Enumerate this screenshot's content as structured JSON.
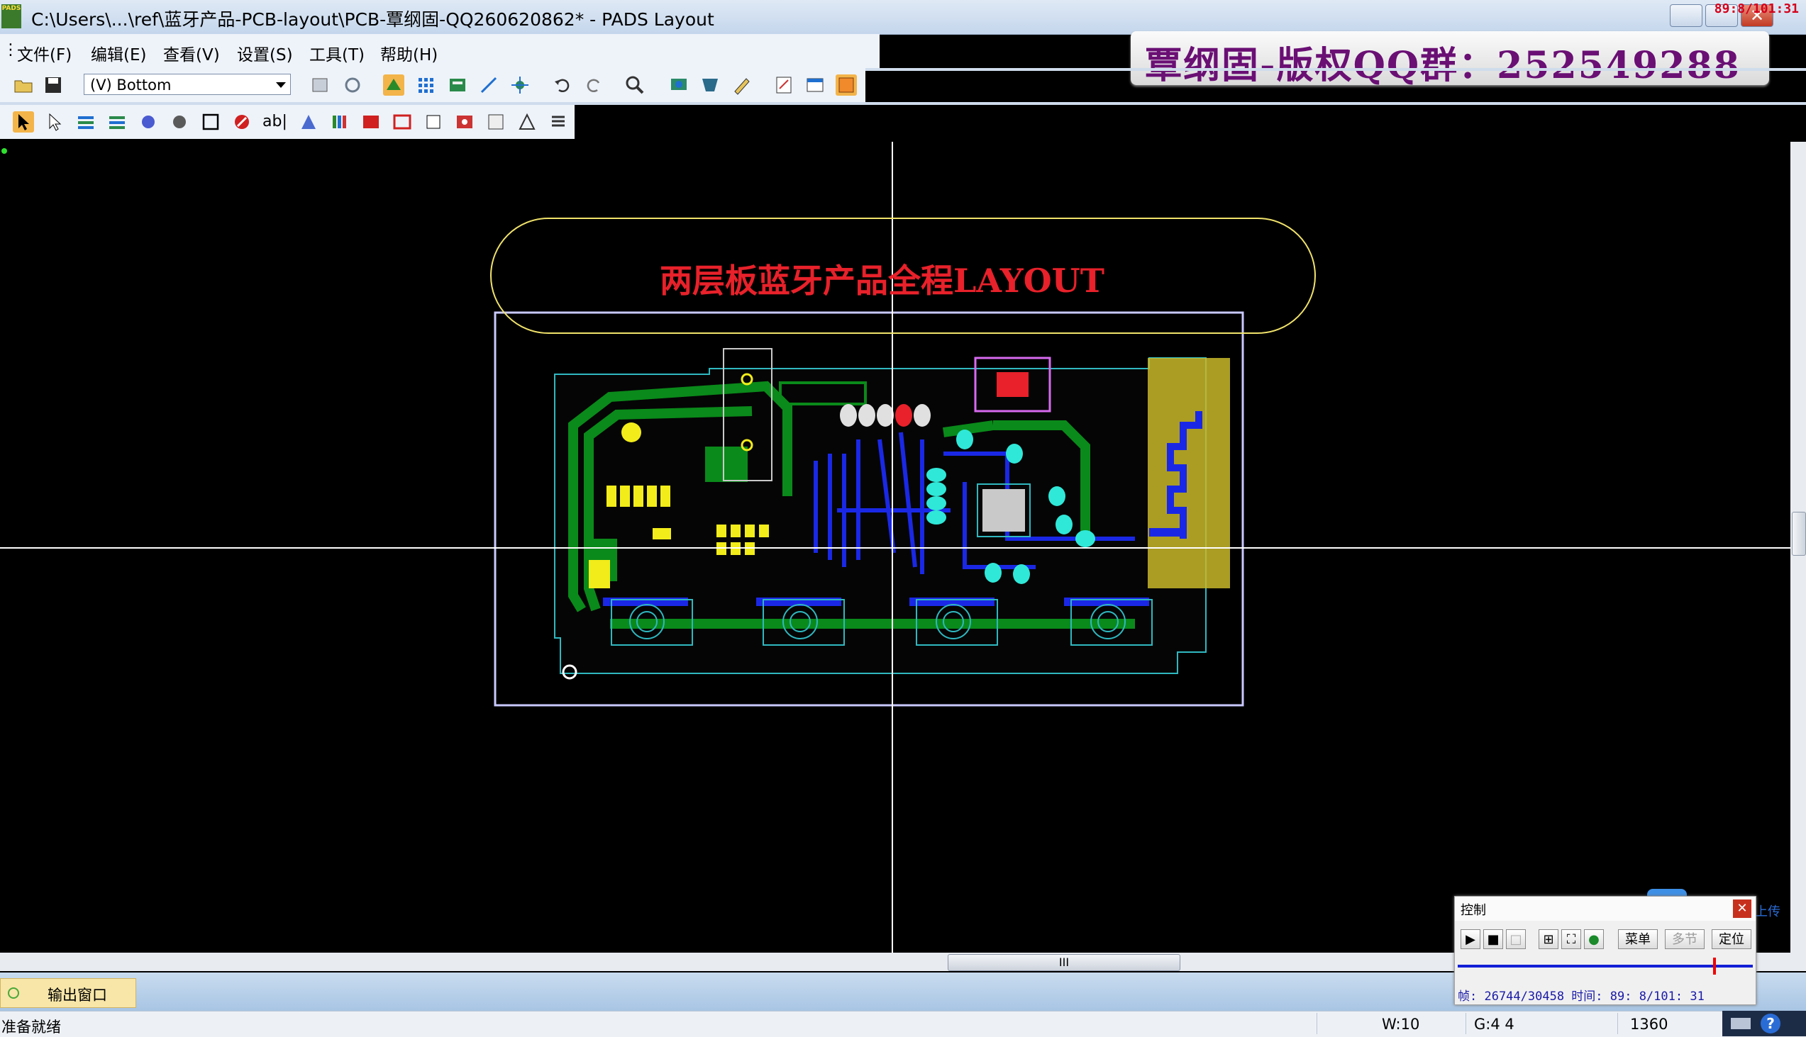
{
  "app": {
    "window_title": "C:\\Users\\...\\ref\\蓝牙产品-PCB-layout\\PCB-覃纲固-QQ260620862* - PADS Layout",
    "logo_text": "PADS",
    "timestamp": "89:8/101:31"
  },
  "menu": [
    "文件(F)",
    "编辑(E)",
    "查看(V)",
    "设置(S)",
    "工具(T)",
    "帮助(H)"
  ],
  "banner": {
    "text": "覃纲固-版权QQ群：252549288"
  },
  "toolbar": {
    "layer_select_value": "(V) Bottom"
  },
  "canvas": {
    "annotation_text": "两层板蓝牙产品全程LAYOUT",
    "colors": {
      "background": "#000000",
      "top_copper": "#0a8a1a",
      "bottom_copper": "#1a28e6",
      "pads": "#f2ec1a",
      "outline": "#c9c9ff",
      "crosshair": "#ffffff",
      "annotation": "#e8212a",
      "ellipse": "#f0e26a"
    }
  },
  "output_window": {
    "tab_label": "输出窗口"
  },
  "status": {
    "message": "准备就绪",
    "width": "W:10",
    "grid": "G:4 4",
    "coord": "1360"
  },
  "control_panel": {
    "title": "控制",
    "menu_label": "菜单",
    "chapter_label": "多节",
    "locate_label": "定位",
    "readout": "帧: 26744/30458  时间: 89: 8/101: 31"
  },
  "upload_label": "上传"
}
